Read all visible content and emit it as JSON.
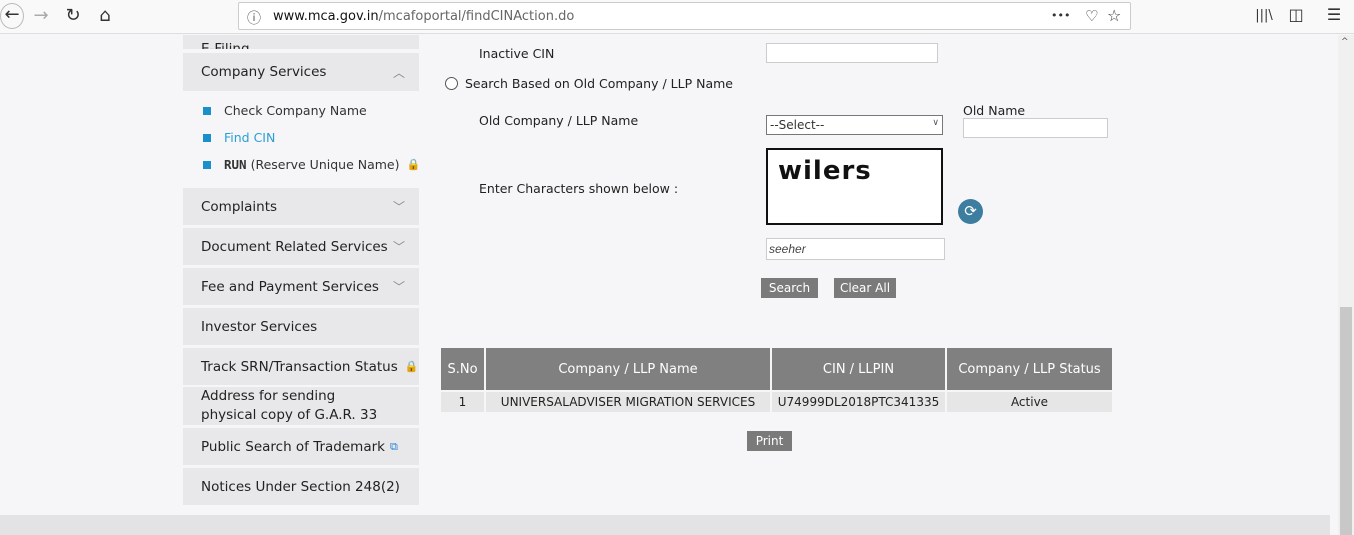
{
  "browser": {
    "url_domain": "www.mca.gov.in",
    "url_path": "/mcafoportal/findCINAction.do",
    "back": "←",
    "forward": "→",
    "reload": "↻",
    "home": "⌂",
    "info": "ⓘ",
    "more": "•••",
    "pocket": "♡",
    "bookmark": "☆",
    "library": "|||\\",
    "sidebar": "◫",
    "menu": "☰"
  },
  "sidebar": {
    "top_partial": "E-Filing",
    "company_services": "Company Services",
    "sub_items": [
      {
        "label": "Check Company Name"
      },
      {
        "label": "Find CIN"
      },
      {
        "label_bold": "RUN",
        "label": "(Reserve Unique Name)"
      }
    ],
    "items": [
      "Complaints",
      "Document Related Services",
      "Fee and Payment Services",
      "Investor Services",
      "Track SRN/Transaction Status",
      "Address for sending physical copy of G.A.R. 33",
      "Public Search of Trademark",
      "Notices Under Section 248(2)"
    ]
  },
  "form": {
    "inactive_cin_label": "Inactive CIN",
    "inactive_cin_value": "",
    "radio_old_name": "Search Based on Old Company / LLP Name",
    "old_company_label": "Old Company / LLP Name",
    "select_value": "--Select--",
    "old_name_label": "Old Name",
    "old_name_value": "",
    "captcha_label": "Enter Characters shown below :",
    "captcha_text": "wilers",
    "captcha_input": "seeher",
    "search": "Search",
    "clear_all": "Clear All"
  },
  "results": {
    "headers": [
      "S.No",
      "Company / LLP Name",
      "CIN / LLPIN",
      "Company / LLP Status"
    ],
    "rows": [
      [
        "1",
        "UNIVERSALADVISER MIGRATION SERVICES",
        "U74999DL2018PTC341335",
        "Active"
      ]
    ],
    "print": "Print"
  }
}
